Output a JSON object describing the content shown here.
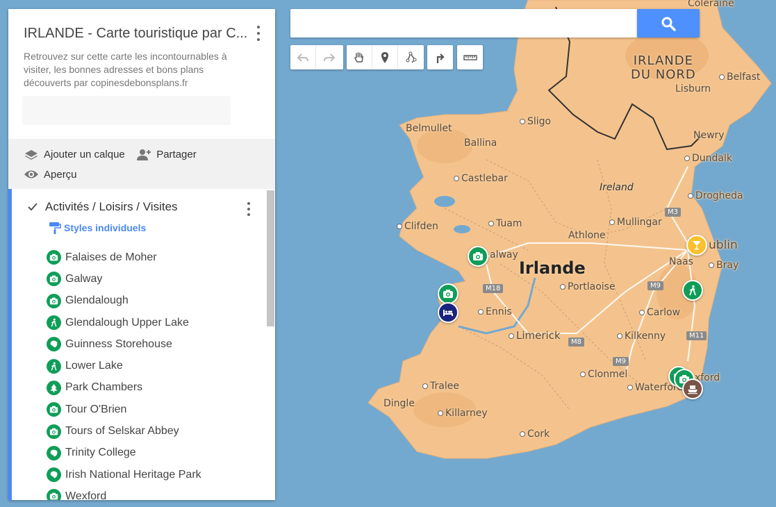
{
  "panel": {
    "title": "IRLANDE - Carte touristique par C...",
    "description": "Retrouvez sur cette carte les incontournables à visiter, les bonnes adresses et bons plans découverts par copinesdebonsplans.fr",
    "actions": {
      "add_layer": "Ajouter un calque",
      "share": "Partager",
      "preview": "Aperçu"
    },
    "layer": {
      "title": "Activités / Loisirs / Visites",
      "checked": true,
      "styles_label": "Styles individuels",
      "items": [
        {
          "label": "Falaises de Moher",
          "icon": "camera-icon"
        },
        {
          "label": "Galway",
          "icon": "camera-icon"
        },
        {
          "label": "Glendalough",
          "icon": "camera-icon"
        },
        {
          "label": "Glendalough Upper Lake",
          "icon": "hiker-icon"
        },
        {
          "label": "Guinness Storehouse",
          "icon": "landmark-icon"
        },
        {
          "label": "Lower Lake",
          "icon": "hiker-icon"
        },
        {
          "label": "Park Chambers",
          "icon": "tree-icon"
        },
        {
          "label": "Tour O'Brien",
          "icon": "camera-icon"
        },
        {
          "label": "Tours of Selskar Abbey",
          "icon": "camera-icon"
        },
        {
          "label": "Trinity College",
          "icon": "landmark-icon"
        },
        {
          "label": "Irish National Heritage Park",
          "icon": "landmark-icon"
        },
        {
          "label": "Wexford",
          "icon": "camera-icon"
        }
      ]
    }
  },
  "search": {
    "placeholder": "",
    "value": ""
  },
  "toolbar": {
    "undo": "undo-icon",
    "redo": "redo-icon",
    "pan": "hand-icon",
    "marker": "marker-icon",
    "line": "draw-line-icon",
    "directions": "directions-icon",
    "measure": "ruler-icon"
  },
  "map": {
    "labels": {
      "country": "Irlande",
      "country_ref": "Ireland",
      "north_line1": "IRLANDE",
      "north_line2": "DU NORD",
      "coleraine": "Coleraine",
      "belfast": "Belfast",
      "lisburn": "Lisburn",
      "newry": "Newry",
      "dundalk": "Dundalk",
      "drogheda": "Drogheda",
      "sligo": "Sligo",
      "belmullet": "Belmullet",
      "ballina": "Ballina",
      "castlebar": "Castlebar",
      "clifden": "Clifden",
      "tuam": "Tuam",
      "mullingar": "Mullingar",
      "athlone": "Athlone",
      "galway": "alway",
      "dublin": "ublin",
      "naas": "Naas",
      "bray": "Bray",
      "portlaoise": "Portlaoise",
      "carlow": "Carlow",
      "ennis": "Ennis",
      "limerick": "Limerick",
      "kilkenny": "Kilkenny",
      "clonmel": "Clonmel",
      "waterford": "Waterford",
      "wexford": "xford",
      "tralee": "Tralee",
      "dingle": "Dingle",
      "killarney": "Killarney",
      "cork": "Cork"
    },
    "roads": {
      "m3": "M3",
      "m9a": "M9",
      "m18": "M18",
      "m8": "M8",
      "m9b": "M9",
      "m11": "M11"
    },
    "colors": {
      "sea": "#74a9cf",
      "land": "#f4c38d",
      "accent": "#4d90fe",
      "green_pin": "#0f9d58",
      "blue_pin": "#1a237e",
      "yellow_pin": "#fbc02d",
      "brown_pin": "#795548"
    }
  }
}
